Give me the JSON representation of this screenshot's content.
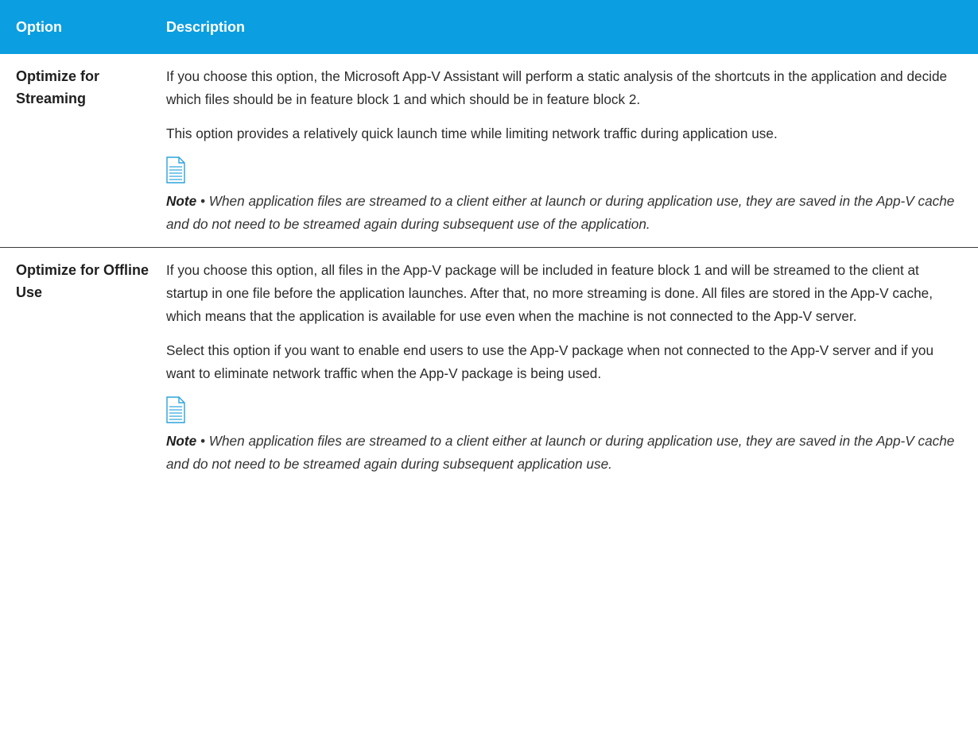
{
  "table": {
    "headers": {
      "option": "Option",
      "description": "Description"
    },
    "rows": [
      {
        "option": "Optimize for Streaming",
        "paragraphs": [
          "If you choose this option, the Microsoft App-V Assistant will perform a static analysis of the shortcuts in the application and decide which files should be in feature block 1 and which should be in feature block 2.",
          "This option provides a relatively quick launch time while limiting network traffic during application use."
        ],
        "note_icon": "note-document-icon",
        "note_label": "Note",
        "note_text": " • When application files are streamed to a client either at launch or during application use, they are saved in the App-V cache and do not need to be streamed again during subsequent use of the application."
      },
      {
        "option": "Optimize for Offline Use",
        "paragraphs": [
          "If you choose this option, all files in the App-V package will be included in feature block 1 and will be streamed to the client at startup in one file before the application launches. After that, no more streaming is done. All files are stored in the App-V cache, which means that the application is available for use even when the machine is not connected to the App-V server.",
          "Select this option if you want to enable end users to use the App-V package when not connected to the App-V server and if you want to eliminate network traffic when the App-V package is being used."
        ],
        "note_icon": "note-document-icon",
        "note_label": "Note",
        "note_text": " • When application files are streamed to a client either at launch or during application use, they are saved in the App-V cache and do not need to be streamed again during subsequent application use."
      }
    ]
  },
  "colors": {
    "header_bg": "#0b9ee0",
    "header_text": "#ffffff",
    "icon_stroke": "#2aa3dc"
  }
}
